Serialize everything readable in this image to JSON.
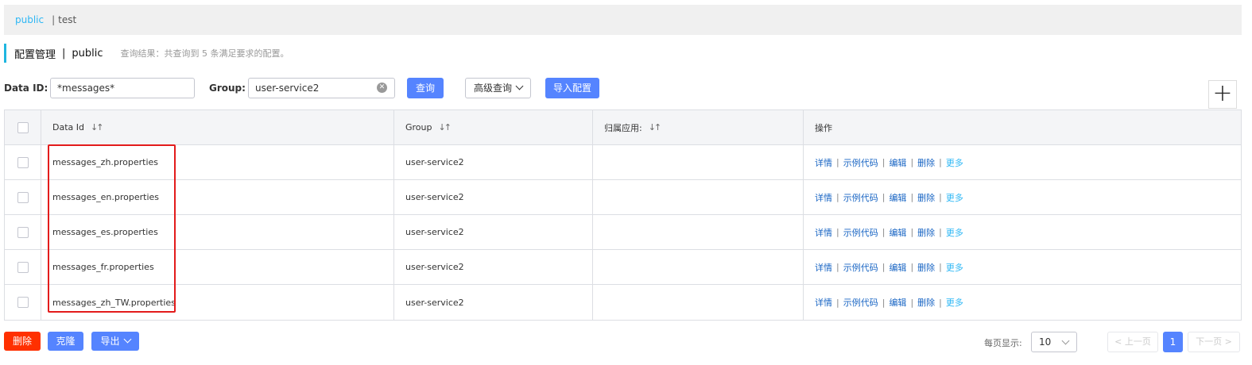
{
  "namespaces": {
    "active": "public",
    "separator": "|",
    "other": "test"
  },
  "title": {
    "main": "配置管理",
    "separator": "|",
    "namespace": "public",
    "hint": "查询结果：共查询到 5 条满足要求的配置。"
  },
  "search": {
    "data_id_label": "Data ID:",
    "data_id_value": "*messages*",
    "group_label": "Group:",
    "group_value": "user-service2",
    "query_button": "查询",
    "advanced_button": "高级查询",
    "import_button": "导入配置",
    "add_button": "+"
  },
  "table": {
    "headers": [
      "Data Id",
      "Group",
      "归属应用:",
      "操作"
    ],
    "sort_icon": "↓↑",
    "rows": [
      {
        "data_id": "messages_zh.properties",
        "group": "user-service2",
        "app": ""
      },
      {
        "data_id": "messages_en.properties",
        "group": "user-service2",
        "app": ""
      },
      {
        "data_id": "messages_es.properties",
        "group": "user-service2",
        "app": ""
      },
      {
        "data_id": "messages_fr.properties",
        "group": "user-service2",
        "app": ""
      },
      {
        "data_id": "messages_zh_TW.properties",
        "group": "user-service2",
        "app": ""
      }
    ],
    "ops": {
      "detail": "详情",
      "sample": "示例代码",
      "edit": "编辑",
      "delete": "删除",
      "more": "更多",
      "sep": "|"
    }
  },
  "bottom": {
    "delete_button": "删除",
    "clone_button": "克隆",
    "export_button": "导出",
    "page_size_label": "每页显示:",
    "page_size": "10",
    "prev_button": "< 上一页",
    "current_page": "1",
    "next_button": "下一页 >"
  },
  "colors": {
    "primary": "#5584ff",
    "danger": "#ff3000",
    "highlight": "#e31b1b",
    "link": "#1a66c4",
    "accent": "#2db7f5"
  },
  "icons": {
    "clear": "clear-icon",
    "chevron": "chevron-down-icon",
    "sort": "sort-icon"
  }
}
